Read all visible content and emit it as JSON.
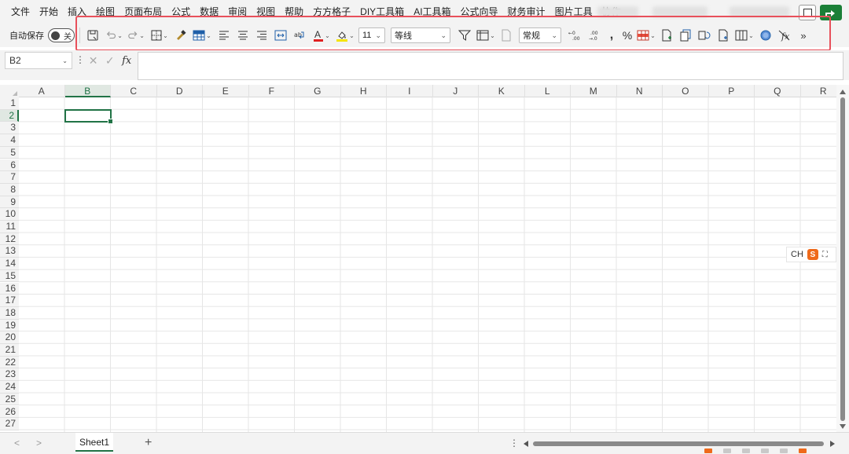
{
  "menu": {
    "items": [
      "文件",
      "开始",
      "插入",
      "绘图",
      "页面布局",
      "公式",
      "数据",
      "审阅",
      "视图",
      "帮助",
      "方方格子",
      "DIY工具箱",
      "AI工具箱",
      "公式向导",
      "财务审计",
      "图片工具",
      "协作"
    ]
  },
  "toolbar": {
    "autosave_label": "自动保存",
    "autosave_state": "关",
    "font_size": "11",
    "font_name": "等线",
    "number_format": "常规",
    "more": "»",
    "font_color": "#e02020",
    "fill_color": "#f5e400",
    "accent": "#217346",
    "highlight_border": "#e8505b"
  },
  "formula_bar": {
    "name_box": "B2",
    "cancel_icon": "✕",
    "enter_icon": "✓",
    "fx": "fx",
    "value": ""
  },
  "grid": {
    "columns": [
      "A",
      "B",
      "C",
      "D",
      "E",
      "F",
      "G",
      "H",
      "I",
      "J",
      "K",
      "L",
      "M",
      "N",
      "O",
      "P",
      "Q",
      "R"
    ],
    "rows": [
      "1",
      "2",
      "3",
      "4",
      "5",
      "6",
      "7",
      "8",
      "9",
      "10",
      "11",
      "12",
      "13",
      "14",
      "15",
      "16",
      "17",
      "18",
      "19",
      "20",
      "21",
      "22",
      "23",
      "24",
      "25",
      "26",
      "27"
    ],
    "selected_column": "B",
    "selected_row": "2"
  },
  "ime": {
    "lang": "CH",
    "logo": "S",
    "expand": "⛶"
  },
  "sheets": {
    "tabs": [
      "Sheet1"
    ],
    "active": "Sheet1",
    "add": "+",
    "prev": "<",
    "next": ">"
  }
}
